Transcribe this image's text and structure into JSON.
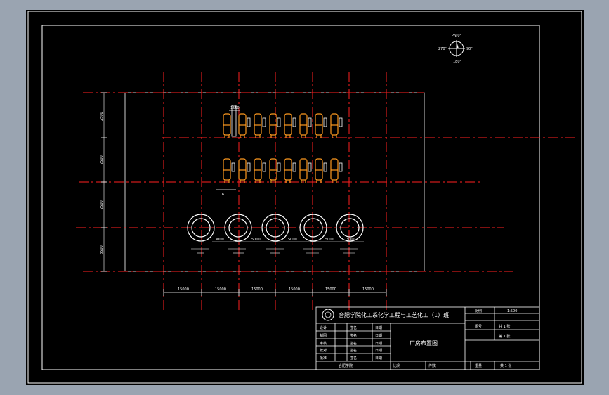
{
  "compass": {
    "north_label": "PN 0°",
    "east_label": "90°",
    "south_label": "180°",
    "west_label": "270°"
  },
  "dims": {
    "vertical": [
      "2500",
      "2500",
      "2500",
      "3500"
    ],
    "horizontal": [
      "15000",
      "15000",
      "15000",
      "15000",
      "15000",
      "15000"
    ],
    "top_small": "1550",
    "tank_gaps": [
      "3000",
      "5000",
      "5000",
      "5000",
      "3000"
    ]
  },
  "equipment_tags": {
    "row_label": "6",
    "tank_labels": [
      "",
      "",
      "",
      "",
      ""
    ]
  },
  "title_block": {
    "school": "合肥学院化工系化学工程与工艺化工（1）班",
    "drawing_title": "厂房布置图",
    "left_col_labels": [
      "设计",
      "制图",
      "审核",
      "校对",
      "批准"
    ],
    "name_cells": [
      "签名",
      "签名",
      "签名",
      "签名",
      "签名"
    ],
    "date_cells": [
      "日期",
      "日期",
      "日期",
      "日期",
      "日期"
    ],
    "right_top": "比例",
    "right_top_value": "1:500",
    "right_rows": [
      "图号",
      "共 1 张",
      "第 1 张"
    ],
    "bottom_cells": [
      "比例",
      "件数",
      "重量",
      "共 1 张"
    ],
    "bottom_left": "合肥学院"
  },
  "colors": {
    "background": "#000000",
    "frame": "#ffffff",
    "centerline": "#ff0000",
    "equipment": "#ff9a1f",
    "tank": "#ffffff"
  }
}
